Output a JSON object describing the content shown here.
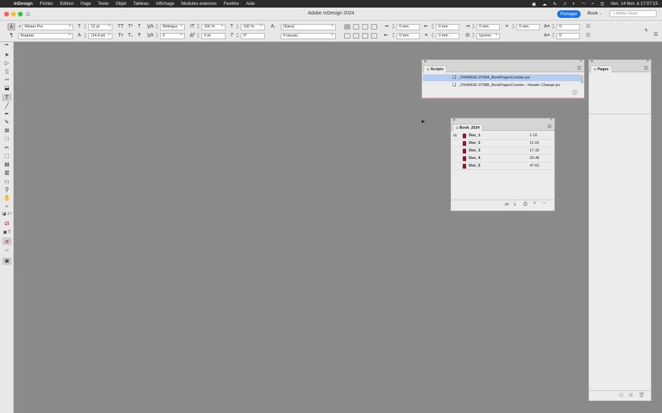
{
  "menubar": {
    "app_name": "InDesign",
    "menus": [
      "Fichier",
      "Edition",
      "Page",
      "Texte",
      "Objet",
      "Tableau",
      "Affichage",
      "Modules externes",
      "Fenêtre",
      "Aide"
    ],
    "datetime": "Ven. 14 févr. à  17:07:15"
  },
  "titlebar": {
    "title": "Adobe InDesign 2024",
    "share_label": "Partager",
    "workspace": "Book",
    "search_placeholder": "Adobe Stock"
  },
  "control": {
    "font_family": "Minion Pro",
    "font_style": "Regular",
    "font_size": "12 pt",
    "leading": "(14,4 pt)",
    "kerning": "Métrique",
    "tracking": "0",
    "vscale": "100 %",
    "hscale": "100 %",
    "baseline_shift": "0 pt",
    "skew": "0°",
    "char_style": "[Sans]",
    "language": "Français",
    "left_indent": "0 mm",
    "right_indent": "0 mm",
    "first_line_indent": "0 mm",
    "last_line_indent": "0 mm",
    "space_before": "0 mm",
    "space_after": "0 mm",
    "hyphenation": "Ignorer",
    "drop_cap_lines": "0",
    "drop_cap_chars": "0"
  },
  "scripts_panel": {
    "tab": "Scripts",
    "items": [
      {
        "name": "_FRIdNGE-0798A_BookPagesCounter.jsx",
        "selected": true
      },
      {
        "name": "_FRIdNGE-0798B_BookPagesCounter - Header Change.jsx",
        "selected": false
      }
    ]
  },
  "book_panel": {
    "tab": "Book_2024",
    "docs": [
      {
        "name": "Doc_1",
        "pages": "1-10"
      },
      {
        "name": "Doc_2",
        "pages": "11-16"
      },
      {
        "name": "Doc_3",
        "pages": "17-32"
      },
      {
        "name": "Doc_4",
        "pages": "33-46"
      },
      {
        "name": "Doc_5",
        "pages": "47-62"
      }
    ]
  },
  "pages_panel": {
    "tab": "Pages"
  },
  "colors": {
    "accent": "#1473e6",
    "selection": "#b5cdee",
    "doc_icon": "#8a1b2b",
    "pasteboard": "#8a8a8a"
  }
}
